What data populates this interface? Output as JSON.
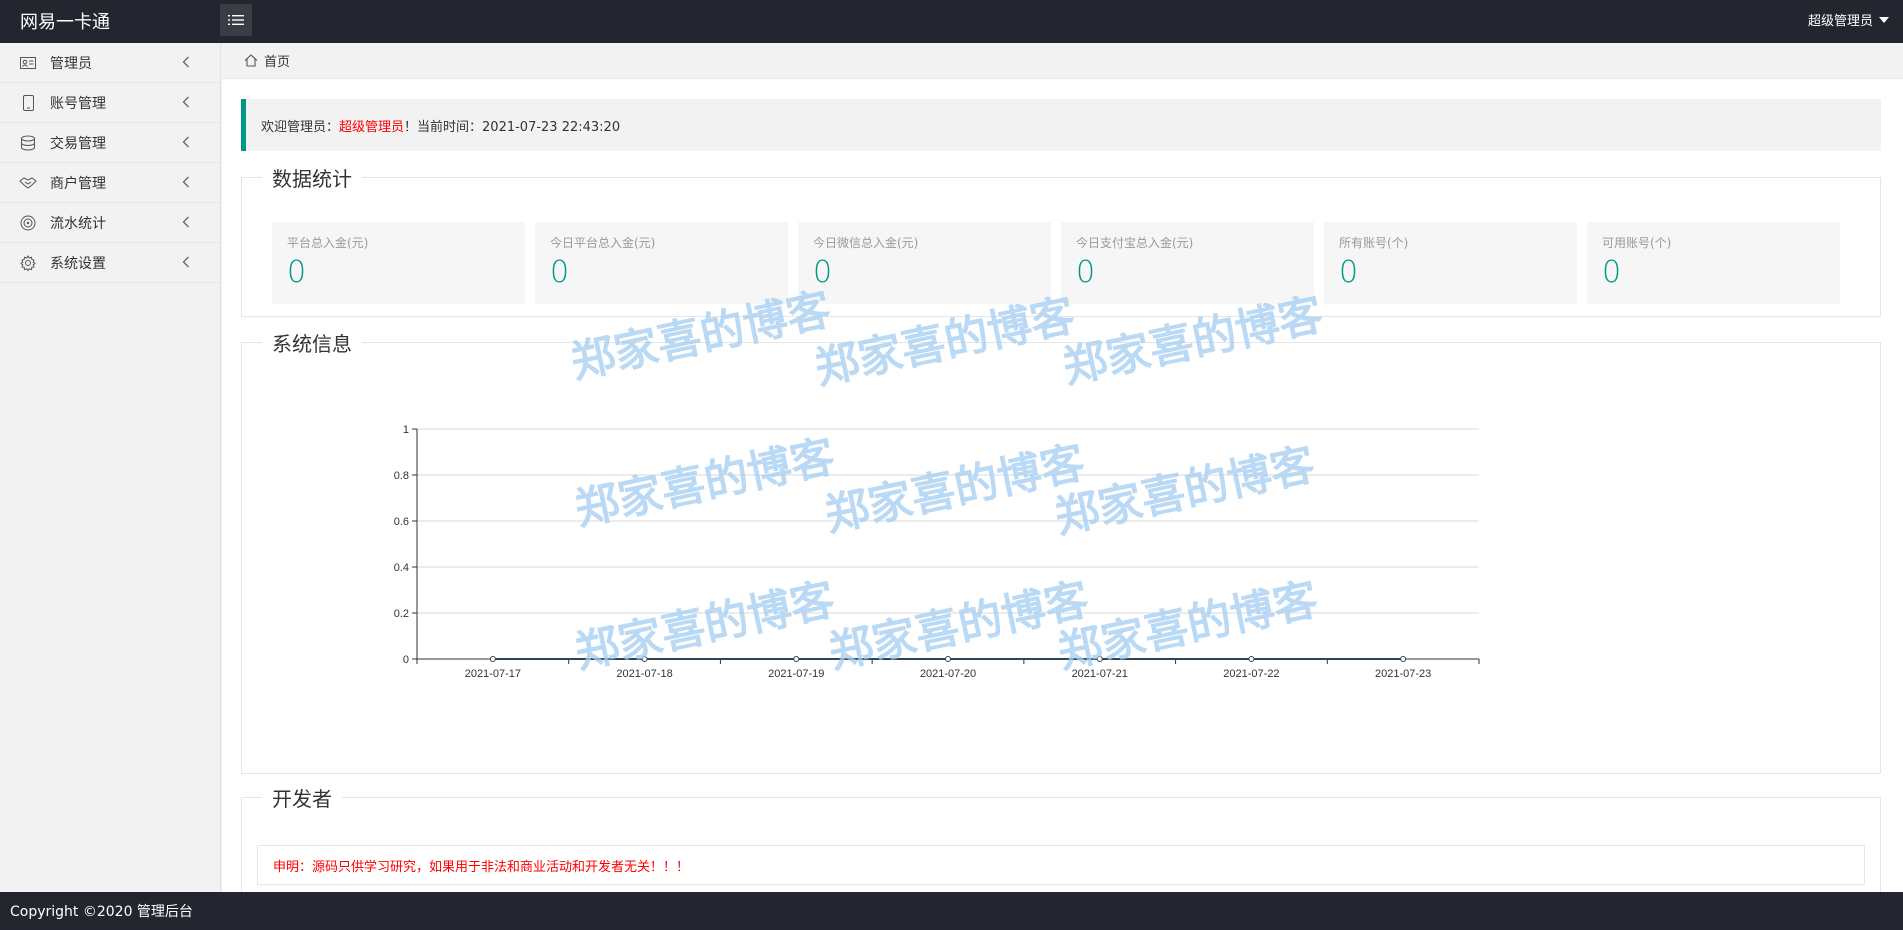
{
  "header": {
    "logo": "网易一卡通",
    "user": "超级管理员"
  },
  "sidebar": {
    "items": [
      {
        "label": "管理员",
        "icon": "id-card-icon"
      },
      {
        "label": "账号管理",
        "icon": "phone-icon"
      },
      {
        "label": "交易管理",
        "icon": "database-icon"
      },
      {
        "label": "商户管理",
        "icon": "handshake-icon"
      },
      {
        "label": "流水统计",
        "icon": "target-icon"
      },
      {
        "label": "系统设置",
        "icon": "gear-icon"
      }
    ]
  },
  "breadcrumb": {
    "home": "首页"
  },
  "welcome": {
    "prefix": "欢迎管理员：",
    "name": "超级管理员",
    "suffix": "！当前时间：2021-07-23 22:43:20"
  },
  "stats": {
    "legend": "数据统计",
    "cards": [
      {
        "label": "平台总入金(元)",
        "value": "0"
      },
      {
        "label": "今日平台总入金(元)",
        "value": "0"
      },
      {
        "label": "今日微信总入金(元)",
        "value": "0"
      },
      {
        "label": "今日支付宝总入金(元)",
        "value": "0"
      },
      {
        "label": "所有账号(个)",
        "value": "0"
      },
      {
        "label": "可用账号(个)",
        "value": "0"
      }
    ]
  },
  "sysinfo": {
    "legend": "系统信息"
  },
  "chart_data": {
    "type": "line",
    "categories": [
      "2021-07-17",
      "2021-07-18",
      "2021-07-19",
      "2021-07-20",
      "2021-07-21",
      "2021-07-22",
      "2021-07-23"
    ],
    "series": [
      {
        "values": [
          0,
          0,
          0,
          0,
          0,
          0,
          0
        ]
      }
    ],
    "y_ticks": [
      "0",
      "0.2",
      "0.4",
      "0.6",
      "0.8",
      "1"
    ],
    "ylim": [
      0,
      1
    ],
    "grid": true
  },
  "developer": {
    "legend": "开发者",
    "notice": "申明：源码只供学习研究，如果用于非法和商业活动和开发者无关！！！"
  },
  "footer": {
    "copyright": "Copyright ©2020 管理后台"
  },
  "watermark": {
    "text": "郑家喜的博客"
  },
  "colors": {
    "accent": "#009688",
    "header_bg": "#23262e",
    "alert": "#ff0000"
  }
}
